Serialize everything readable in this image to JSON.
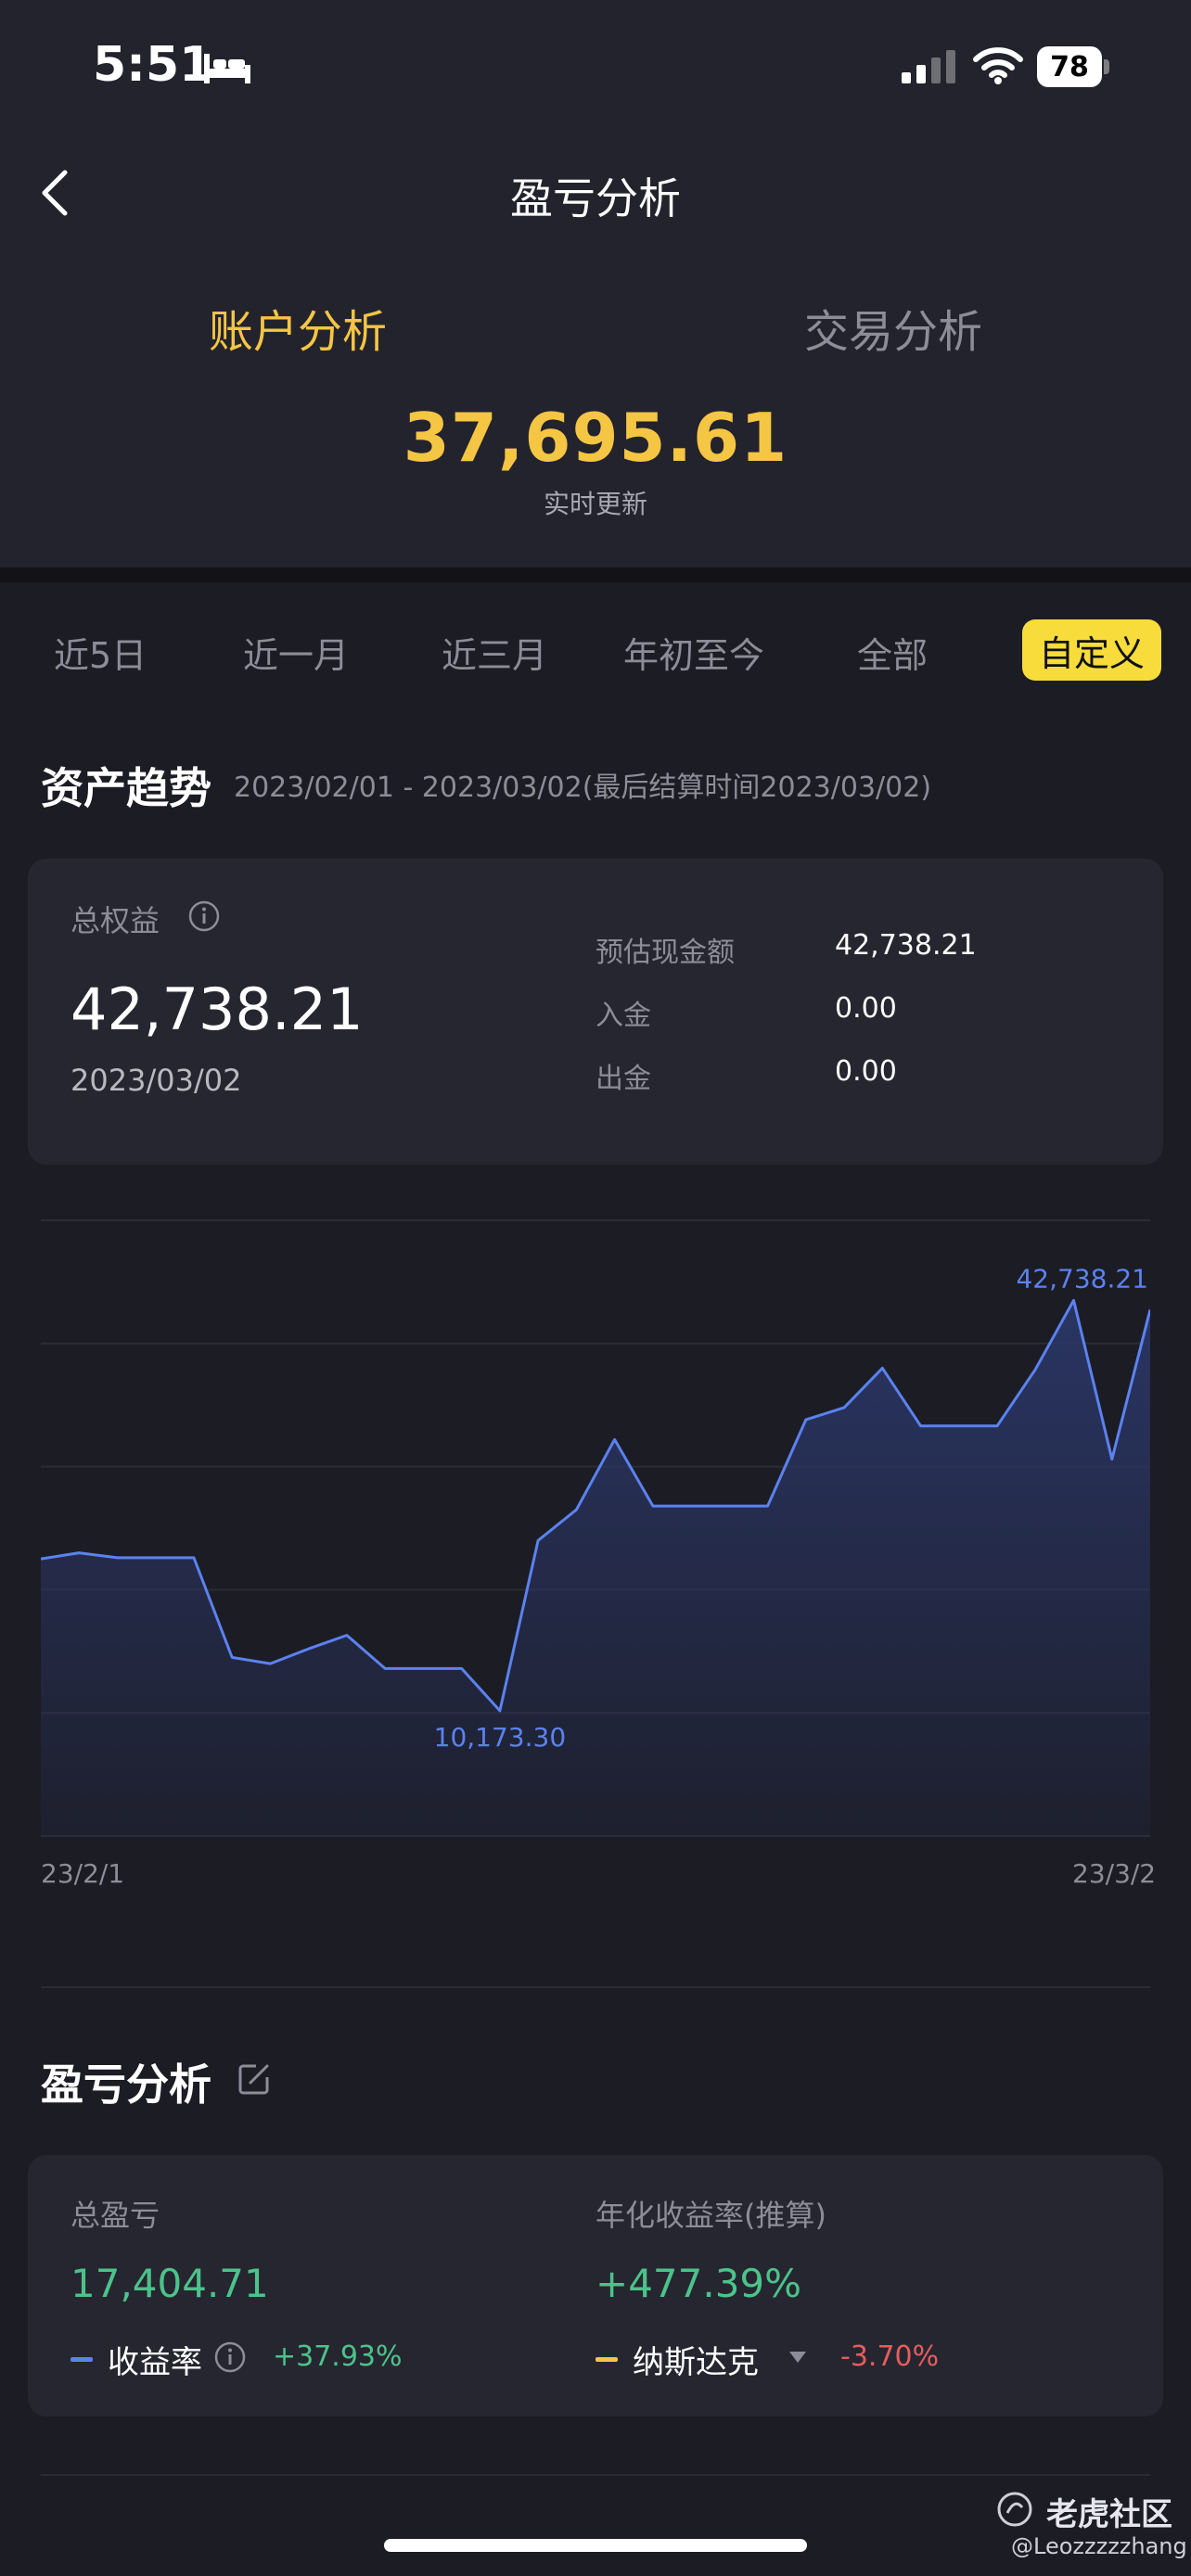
{
  "status_bar": {
    "time": "5:51",
    "battery": "78"
  },
  "nav": {
    "title": "盈亏分析"
  },
  "segments": {
    "account": "账户分析",
    "trade": "交易分析"
  },
  "balance": {
    "value": "37,695.61",
    "sub": "实时更新"
  },
  "ranges": {
    "items": [
      "近5日",
      "近一月",
      "近三月",
      "年初至今",
      "全部"
    ],
    "active": "自定义"
  },
  "trend": {
    "title": "资产趋势",
    "subtitle": "2023/02/01 - 2023/03/02(最后结算时间2023/03/02)"
  },
  "equity_card": {
    "label": "总权益",
    "value": "42,738.21",
    "date": "2023/03/02",
    "rows": [
      {
        "label": "预估现金额",
        "value": "42,738.21"
      },
      {
        "label": "入金",
        "value": "0.00"
      },
      {
        "label": "出金",
        "value": "0.00"
      }
    ]
  },
  "chart_data": {
    "type": "area",
    "x_start_label": "23/2/1",
    "x_end_label": "23/3/2",
    "max_label": "42,738.21",
    "min_label": "10,173.30",
    "values": [
      22500,
      23000,
      22600,
      22600,
      22600,
      14500,
      14000,
      15200,
      16300,
      13600,
      13600,
      13600,
      10173.3,
      24000,
      26500,
      32200,
      26800,
      26800,
      26800,
      26800,
      33800,
      34800,
      38000,
      33300,
      33300,
      33300,
      37900,
      43500,
      30600,
      42738.21
    ],
    "ylim": [
      0,
      50000
    ],
    "grid": true,
    "colors": {
      "line": "#5b82f0",
      "fill": "#2a3666"
    }
  },
  "pnl": {
    "title": "盈亏分析",
    "total_label": "总盈亏",
    "total_value": "17,404.71",
    "annual_label": "年化收益率(推算)",
    "annual_value": "+477.39%",
    "rate_label": "收益率",
    "rate_value": "+37.93%",
    "bench_label": "纳斯达克",
    "bench_value": "-3.70%"
  },
  "watermark": {
    "brand": "老虎社区",
    "user": "@Leozzzzzhang"
  }
}
